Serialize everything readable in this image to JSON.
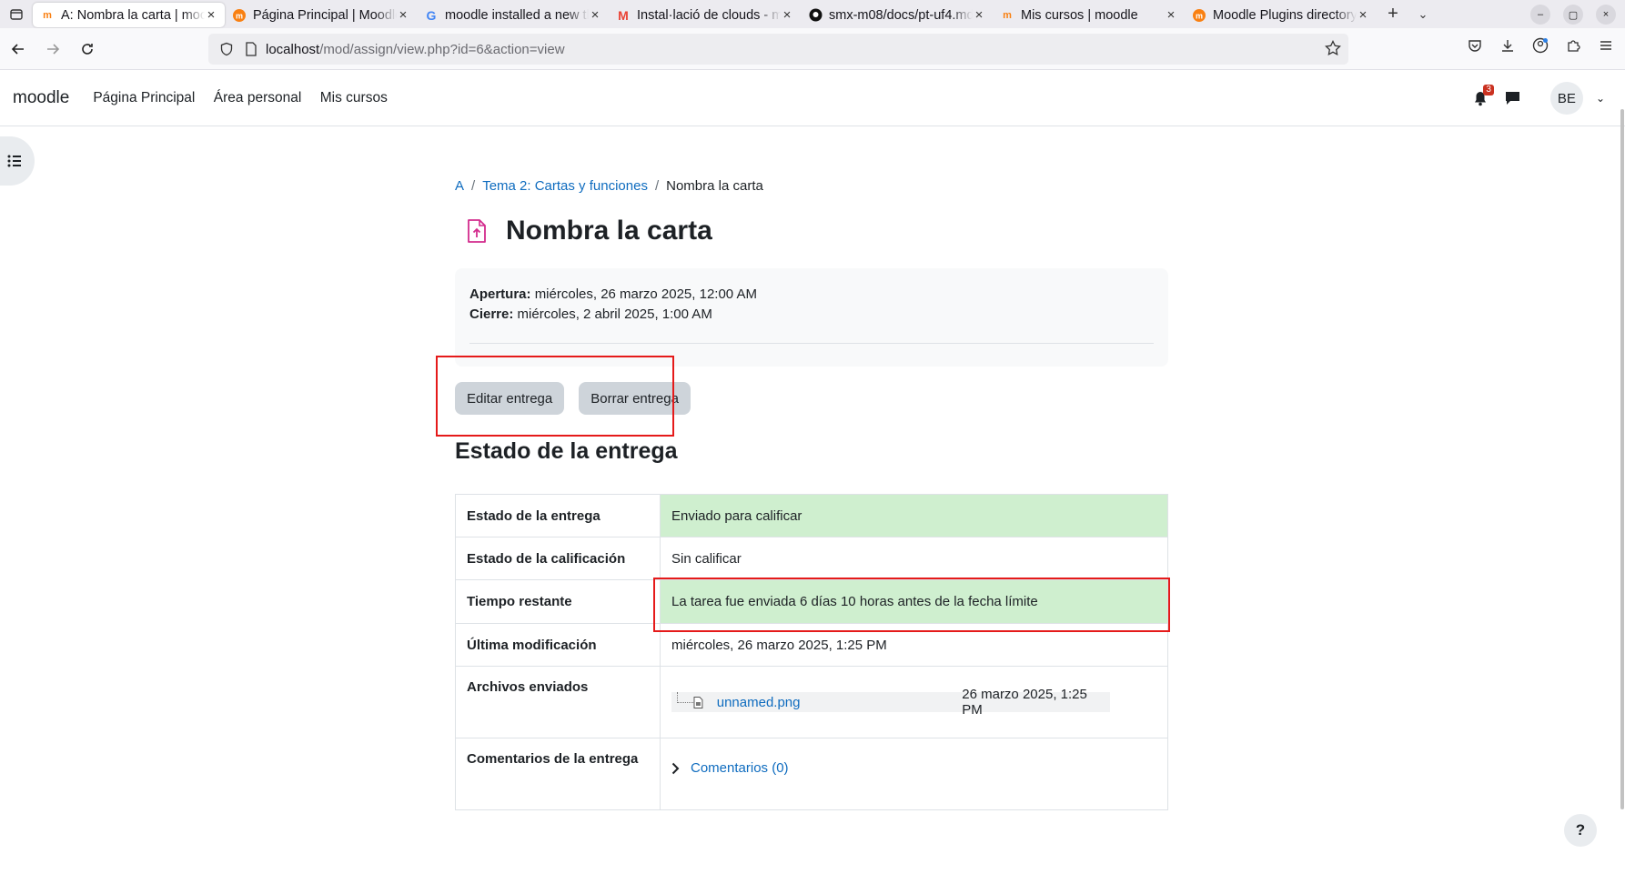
{
  "browser": {
    "tabs": [
      {
        "title": "A: Nombra la carta | moodle",
        "icon": "moodle-m-icon",
        "active": true
      },
      {
        "title": "Página Principal | Moodle",
        "icon": "moodle-org-icon"
      },
      {
        "title": "moodle installed a new theme",
        "icon": "google-g-icon"
      },
      {
        "title": "Instal·lació de clouds - mail",
        "icon": "gmail-icon"
      },
      {
        "title": "smx-m08/docs/pt-uf4.md",
        "icon": "github-icon"
      },
      {
        "title": "Mis cursos | moodle",
        "icon": "moodle-m-icon"
      },
      {
        "title": "Moodle Plugins directory",
        "icon": "moodle-org-icon"
      }
    ],
    "url_host": "localhost",
    "url_path": "/mod/assign/view.php?id=6&action=view"
  },
  "site": {
    "brand": "moodle",
    "nav": [
      "Página Principal",
      "Área personal",
      "Mis cursos"
    ],
    "notifications_count": "3",
    "user_initials": "BE"
  },
  "breadcrumb": [
    "A",
    "Tema 2: Cartas y funciones",
    "Nombra la carta"
  ],
  "page_title": "Nombra la carta",
  "dates": {
    "open_label": "Apertura:",
    "open_value": "miércoles, 26 marzo 2025, 12:00 AM",
    "close_label": "Cierre:",
    "close_value": "miércoles, 2 abril 2025, 1:00 AM"
  },
  "buttons": {
    "edit": "Editar entrega",
    "delete": "Borrar entrega"
  },
  "status_heading": "Estado de la entrega",
  "status_rows": [
    {
      "label": "Estado de la entrega",
      "value": "Enviado para calificar"
    },
    {
      "label": "Estado de la calificación",
      "value": "Sin calificar"
    },
    {
      "label": "Tiempo restante",
      "value": "La tarea fue enviada 6 días 10 horas antes de la fecha límite"
    },
    {
      "label": "Última modificación",
      "value": "miércoles, 26 marzo 2025, 1:25 PM"
    },
    {
      "label": "Archivos enviados",
      "file_name": "unnamed.png",
      "file_date": "26 marzo 2025, 1:25 PM"
    },
    {
      "label": "Comentarios de la entrega",
      "comments_link": "Comentarios (0)"
    }
  ],
  "colors": {
    "success_bg": "#cfefcf",
    "link": "#0f6cbf",
    "annotation_red": "#e51a1a"
  }
}
